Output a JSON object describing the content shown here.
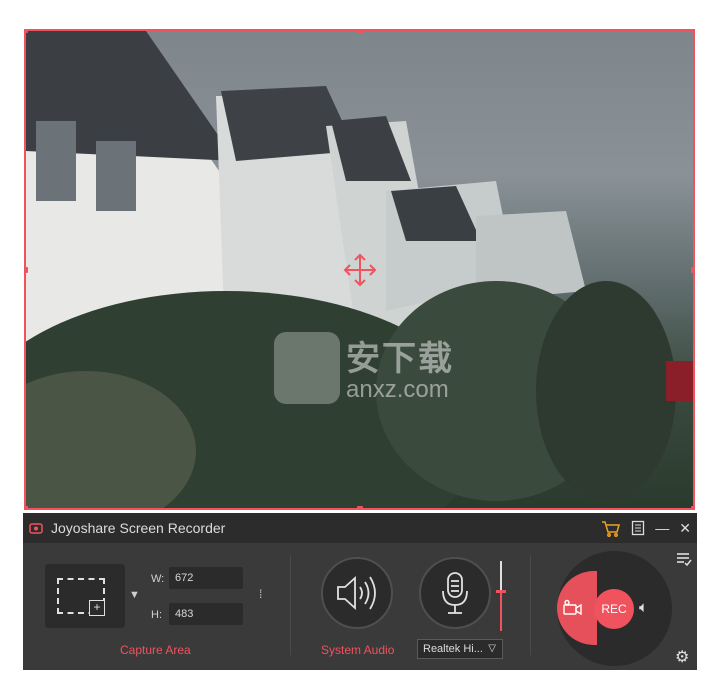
{
  "app": {
    "title": "Joyoshare Screen Recorder"
  },
  "watermark": {
    "brand": "安下载",
    "site": "anxz.com"
  },
  "capture": {
    "width_label": "W:",
    "height_label": "H:",
    "width_value": "672",
    "height_value": "483",
    "caption": "Capture Area"
  },
  "audio": {
    "system_caption": "System Audio",
    "mic_device": "Realtek Hi...",
    "mic_volume_fraction": 0.57
  },
  "record": {
    "label": "REC"
  },
  "colors": {
    "accent": "#f0525e",
    "panel": "#3a3a3a",
    "titlebar": "#2c2c2c"
  }
}
